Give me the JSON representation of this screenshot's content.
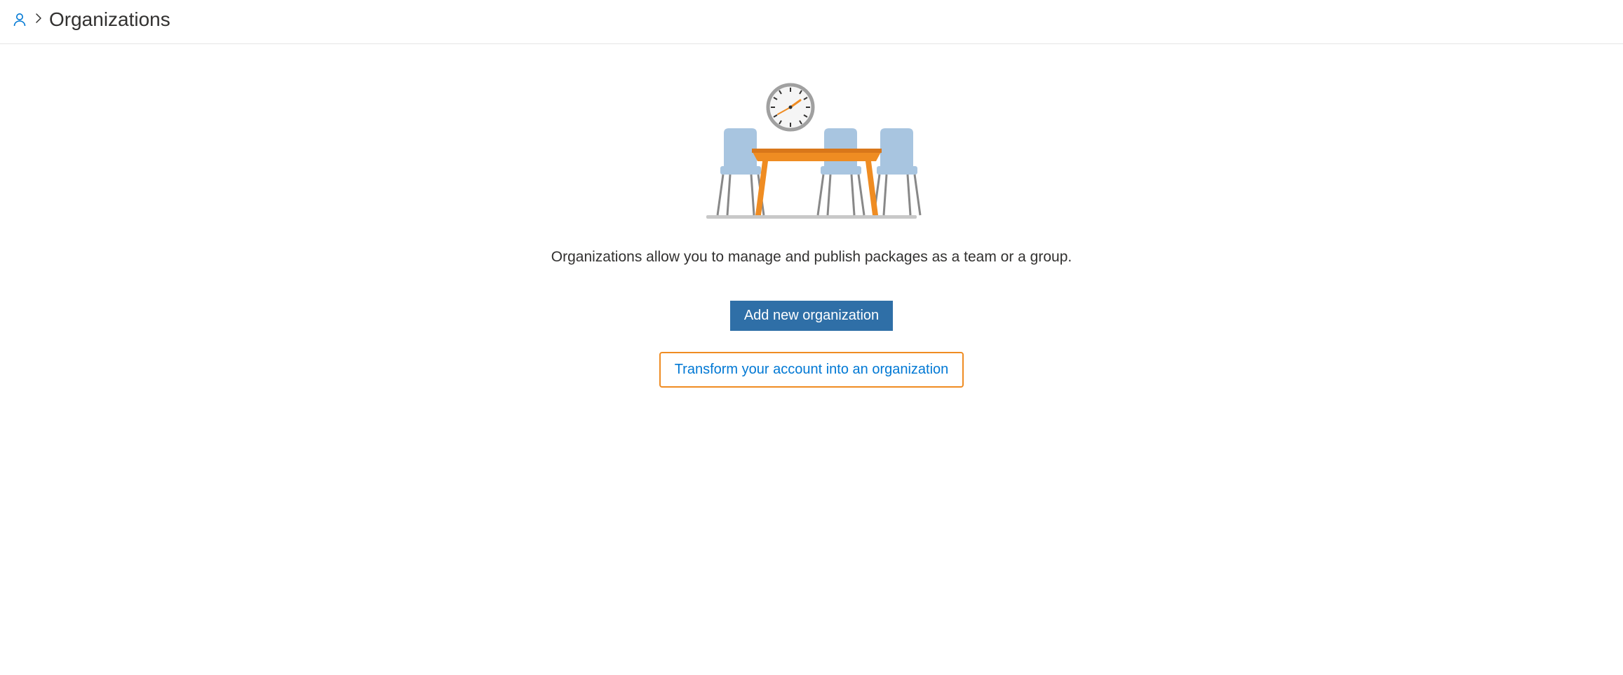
{
  "breadcrumb": {
    "page_title": "Organizations"
  },
  "empty": {
    "description": "Organizations allow you to manage and publish packages as a team or a group.",
    "add_button_label": "Add new organization",
    "transform_button_label": "Transform your account into an organization"
  },
  "colors": {
    "accent_blue": "#0078d4",
    "button_blue": "#2f6fa7",
    "highlight_orange": "#ef8c22",
    "illustration_chair": "#a8c5e0",
    "illustration_table": "#ef8c22"
  }
}
